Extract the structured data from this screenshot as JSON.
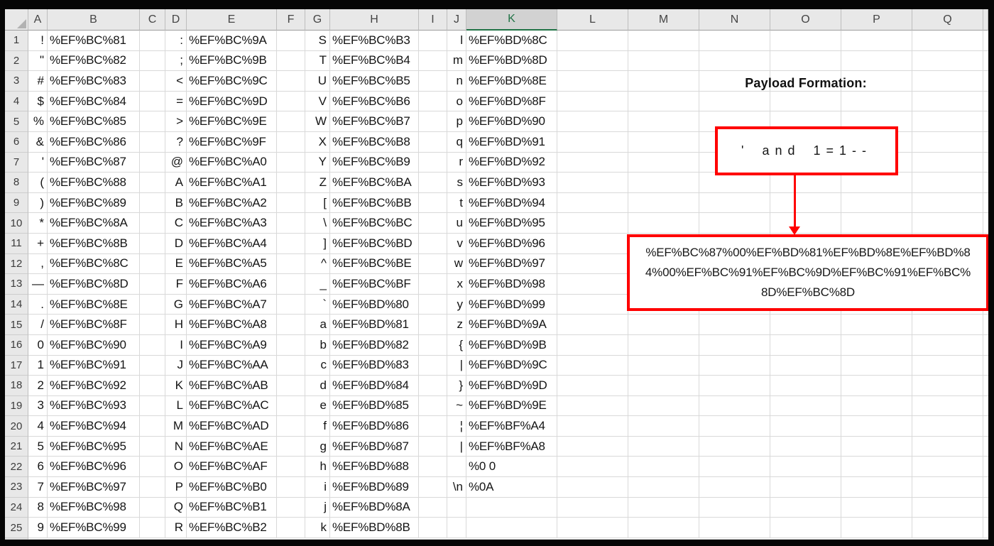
{
  "app": {
    "type": "spreadsheet-worksheet"
  },
  "colors": {
    "accent_red": "#ff0000",
    "selected_green": "#217346",
    "header_bg": "#e8e8e8",
    "selected_header_bg": "#d2d2d2",
    "gridline": "#d9d9d9",
    "frame": "#060606"
  },
  "grid": {
    "selected_column": "K",
    "row_count": 25,
    "row_numbers": [
      1,
      2,
      3,
      4,
      5,
      6,
      7,
      8,
      9,
      10,
      11,
      12,
      13,
      14,
      15,
      16,
      17,
      18,
      19,
      20,
      21,
      22,
      23,
      24,
      25
    ],
    "columns": [
      {
        "letter": "A",
        "kind": "char",
        "cells": [
          "!",
          "\"",
          "#",
          "$",
          "%",
          "&",
          "'",
          "(",
          ")",
          "*",
          "+",
          ",",
          "—",
          ".",
          "/",
          "0",
          "1",
          "2",
          "3",
          "4",
          "5",
          "6",
          "7",
          "8",
          "9"
        ]
      },
      {
        "letter": "B",
        "kind": "code",
        "cells": [
          "%EF%BC%81",
          "%EF%BC%82",
          "%EF%BC%83",
          "%EF%BC%84",
          "%EF%BC%85",
          "%EF%BC%86",
          "%EF%BC%87",
          "%EF%BC%88",
          "%EF%BC%89",
          "%EF%BC%8A",
          "%EF%BC%8B",
          "%EF%BC%8C",
          "%EF%BC%8D",
          "%EF%BC%8E",
          "%EF%BC%8F",
          "%EF%BC%90",
          "%EF%BC%91",
          "%EF%BC%92",
          "%EF%BC%93",
          "%EF%BC%94",
          "%EF%BC%95",
          "%EF%BC%96",
          "%EF%BC%97",
          "%EF%BC%98",
          "%EF%BC%99"
        ]
      },
      {
        "letter": "C",
        "kind": "empty",
        "cells": [
          "",
          "",
          "",
          "",
          "",
          "",
          "",
          "",
          "",
          "",
          "",
          "",
          "",
          "",
          "",
          "",
          "",
          "",
          "",
          "",
          "",
          "",
          "",
          "",
          ""
        ]
      },
      {
        "letter": "D",
        "kind": "char",
        "cells": [
          ":",
          ";",
          "<",
          "=",
          ">",
          "?",
          "@",
          "A",
          "B",
          "C",
          "D",
          "E",
          "F",
          "G",
          "H",
          "I",
          "J",
          "K",
          "L",
          "M",
          "N",
          "O",
          "P",
          "Q",
          "R"
        ]
      },
      {
        "letter": "E",
        "kind": "code",
        "cells": [
          "%EF%BC%9A",
          "%EF%BC%9B",
          "%EF%BC%9C",
          "%EF%BC%9D",
          "%EF%BC%9E",
          "%EF%BC%9F",
          "%EF%BC%A0",
          "%EF%BC%A1",
          "%EF%BC%A2",
          "%EF%BC%A3",
          "%EF%BC%A4",
          "%EF%BC%A5",
          "%EF%BC%A6",
          "%EF%BC%A7",
          "%EF%BC%A8",
          "%EF%BC%A9",
          "%EF%BC%AA",
          "%EF%BC%AB",
          "%EF%BC%AC",
          "%EF%BC%AD",
          "%EF%BC%AE",
          "%EF%BC%AF",
          "%EF%BC%B0",
          "%EF%BC%B1",
          "%EF%BC%B2"
        ]
      },
      {
        "letter": "F",
        "kind": "empty",
        "cells": [
          "",
          "",
          "",
          "",
          "",
          "",
          "",
          "",
          "",
          "",
          "",
          "",
          "",
          "",
          "",
          "",
          "",
          "",
          "",
          "",
          "",
          "",
          "",
          "",
          ""
        ]
      },
      {
        "letter": "G",
        "kind": "char",
        "cells": [
          "S",
          "T",
          "U",
          "V",
          "W",
          "X",
          "Y",
          "Z",
          "[",
          "\\",
          "]",
          "^",
          "_",
          "`",
          "a",
          "b",
          "c",
          "d",
          "e",
          "f",
          "g",
          "h",
          "i",
          "j",
          "k"
        ]
      },
      {
        "letter": "H",
        "kind": "code",
        "cells": [
          "%EF%BC%B3",
          "%EF%BC%B4",
          "%EF%BC%B5",
          "%EF%BC%B6",
          "%EF%BC%B7",
          "%EF%BC%B8",
          "%EF%BC%B9",
          "%EF%BC%BA",
          "%EF%BC%BB",
          "%EF%BC%BC",
          "%EF%BC%BD",
          "%EF%BC%BE",
          "%EF%BC%BF",
          "%EF%BD%80",
          "%EF%BD%81",
          "%EF%BD%82",
          "%EF%BD%83",
          "%EF%BD%84",
          "%EF%BD%85",
          "%EF%BD%86",
          "%EF%BD%87",
          "%EF%BD%88",
          "%EF%BD%89",
          "%EF%BD%8A",
          "%EF%BD%8B"
        ]
      },
      {
        "letter": "I",
        "kind": "empty",
        "cells": [
          "",
          "",
          "",
          "",
          "",
          "",
          "",
          "",
          "",
          "",
          "",
          "",
          "",
          "",
          "",
          "",
          "",
          "",
          "",
          "",
          "",
          "",
          "",
          "",
          ""
        ]
      },
      {
        "letter": "J",
        "kind": "char",
        "cells": [
          "l",
          "m",
          "n",
          "o",
          "p",
          "q",
          "r",
          "s",
          "t",
          "u",
          "v",
          "w",
          "x",
          "y",
          "z",
          "{",
          "|",
          "}",
          "~",
          "¦",
          "|",
          "",
          "\\n",
          "",
          ""
        ]
      },
      {
        "letter": "K",
        "kind": "code",
        "cells": [
          "%EF%BD%8C",
          "%EF%BD%8D",
          "%EF%BD%8E",
          "%EF%BD%8F",
          "%EF%BD%90",
          "%EF%BD%91",
          "%EF%BD%92",
          "%EF%BD%93",
          "%EF%BD%94",
          "%EF%BD%95",
          "%EF%BD%96",
          "%EF%BD%97",
          "%EF%BD%98",
          "%EF%BD%99",
          "%EF%BD%9A",
          "%EF%BD%9B",
          "%EF%BD%9C",
          "%EF%BD%9D",
          "%EF%BD%9E",
          "%EF%BF%A4",
          "%EF%BF%A8",
          "%0 0",
          "%0A",
          "",
          ""
        ]
      },
      {
        "letter": "L",
        "kind": "empty",
        "cells": [
          "",
          "",
          "",
          "",
          "",
          "",
          "",
          "",
          "",
          "",
          "",
          "",
          "",
          "",
          "",
          "",
          "",
          "",
          "",
          "",
          "",
          "",
          "",
          "",
          ""
        ]
      },
      {
        "letter": "M",
        "kind": "empty",
        "cells": [
          "",
          "",
          "",
          "",
          "",
          "",
          "",
          "",
          "",
          "",
          "",
          "",
          "",
          "",
          "",
          "",
          "",
          "",
          "",
          "",
          "",
          "",
          "",
          "",
          ""
        ]
      },
      {
        "letter": "N",
        "kind": "empty",
        "cells": [
          "",
          "",
          "",
          "",
          "",
          "",
          "",
          "",
          "",
          "",
          "",
          "",
          "",
          "",
          "",
          "",
          "",
          "",
          "",
          "",
          "",
          "",
          "",
          "",
          ""
        ]
      },
      {
        "letter": "O",
        "kind": "empty",
        "cells": [
          "",
          "",
          "",
          "",
          "",
          "",
          "",
          "",
          "",
          "",
          "",
          "",
          "",
          "",
          "",
          "",
          "",
          "",
          "",
          "",
          "",
          "",
          "",
          "",
          ""
        ]
      },
      {
        "letter": "P",
        "kind": "empty",
        "cells": [
          "",
          "",
          "",
          "",
          "",
          "",
          "",
          "",
          "",
          "",
          "",
          "",
          "",
          "",
          "",
          "",
          "",
          "",
          "",
          "",
          "",
          "",
          "",
          "",
          ""
        ]
      },
      {
        "letter": "Q",
        "kind": "empty",
        "cells": [
          "",
          "",
          "",
          "",
          "",
          "",
          "",
          "",
          "",
          "",
          "",
          "",
          "",
          "",
          "",
          "",
          "",
          "",
          "",
          "",
          "",
          "",
          "",
          "",
          ""
        ]
      }
    ]
  },
  "annotation": {
    "title": "Payload Formation:",
    "payload_text": "' and 1=1--",
    "payload_encoded": "%EF%BC%87%00%EF%BD%81%EF%BD%8E%EF%BD%84%00%EF%BC%91%EF%BC%9D%EF%BC%91%EF%BC%8D%EF%BC%8D",
    "payload_encoded_lines": [
      "%EF%BC%87%00%EF%BD%81%EF%BD%8E%EF%BD%8",
      "4%00%EF%BC%91%EF%BC%9D%EF%BC%91%EF%BC%",
      "8D%EF%BC%8D"
    ]
  }
}
